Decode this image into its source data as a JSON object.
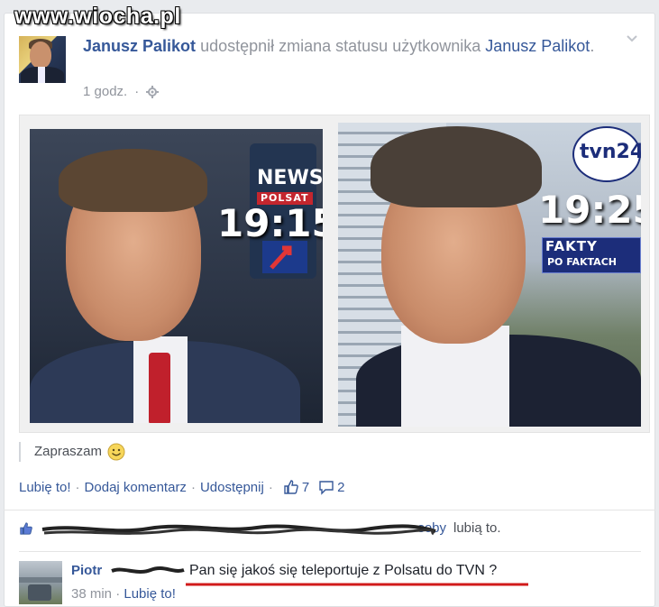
{
  "watermark": "www.wiocha.pl",
  "post": {
    "author": "Janusz Palikot",
    "action_text": "udostępnił zmiana statusu użytkownika",
    "shared_from": "Janusz Palikot",
    "time": "1 godz.",
    "privacy_icon": "gear-icon",
    "caption": "Zapraszam",
    "caption_emoji": "smiley-icon"
  },
  "photos": {
    "left": {
      "channel": "NEWS",
      "subchannel": "POLSAT",
      "time": "19:15"
    },
    "right": {
      "channel": "tvn24",
      "time": "19:25",
      "program": "FAKTY",
      "program_sub": "PO FAKTACH"
    }
  },
  "actions": {
    "like": "Lubię to!",
    "comment": "Dodaj komentarz",
    "share": "Udostępnij",
    "likes_count": "7",
    "comments_count": "2"
  },
  "likes": {
    "names_tail": "soby",
    "suffix": "lubią to."
  },
  "comment": {
    "author": "Piotr",
    "text": "Pan się jakoś się teleportuje z Polsatu do TVN ?",
    "time": "38 min",
    "like": "Lubię to!"
  },
  "colors": {
    "link": "#365899",
    "meta": "#90949c",
    "underline": "#d11a1a"
  }
}
